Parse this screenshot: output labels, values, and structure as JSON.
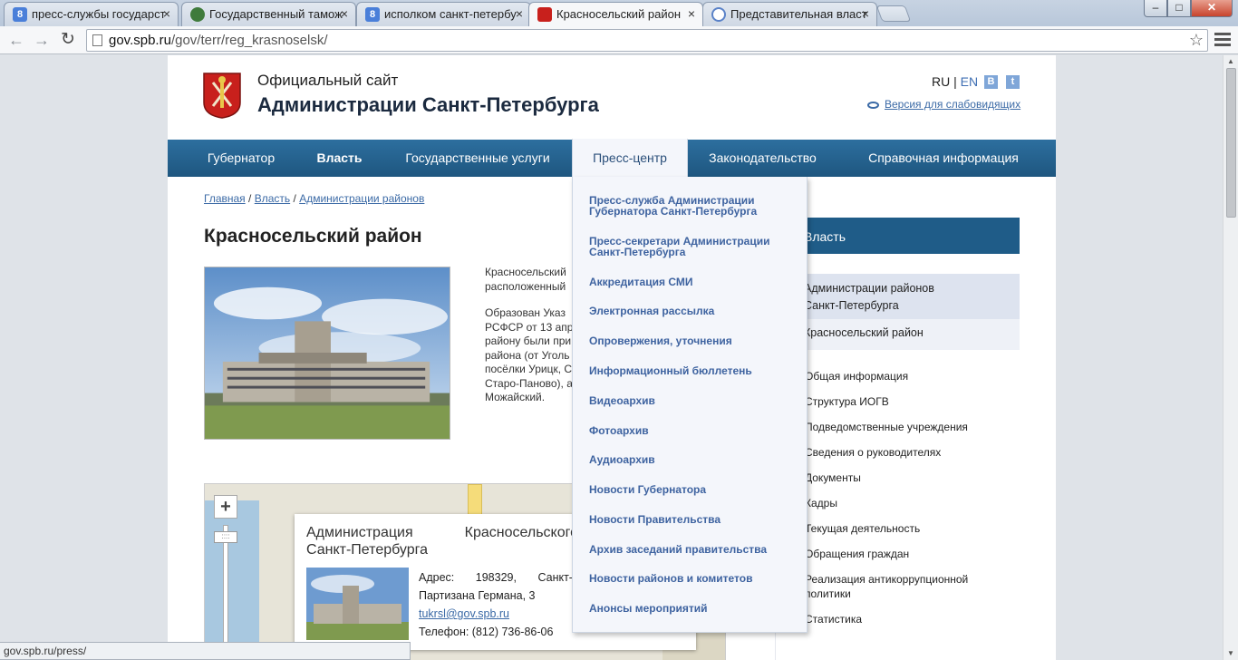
{
  "browser": {
    "tabs": [
      {
        "label": "пресс-службы государст",
        "icon": "google-icon"
      },
      {
        "label": "Государственный тамож",
        "icon": "customs-shield-icon"
      },
      {
        "label": "исполком санкт-петербу",
        "icon": "google-icon"
      },
      {
        "label": "Красносельский район",
        "icon": "spb-coat-of-arms-icon"
      },
      {
        "label": "Представительная власт",
        "icon": "globe-icon"
      }
    ],
    "address": {
      "domain": "gov.spb.ru",
      "path": "/gov/terr/reg_krasnoselsk/"
    },
    "status_url": "gov.spb.ru/press/",
    "close_glyph": "×"
  },
  "site": {
    "title_line1": "Официальный сайт",
    "title_line2": "Администрации Санкт-Петербурга",
    "lang_ru": "RU",
    "lang_sep": "|",
    "lang_en": "EN",
    "vk_label": "B",
    "twitter_label": "t",
    "low_vision": "Версия для слабовидящих",
    "colors": {
      "nav": "#1e567f",
      "link": "#3b6aa6",
      "sidebar_head": "#1f5c88",
      "dropdown_bg": "#f4f6fb"
    }
  },
  "nav": {
    "governor": "Губернатор",
    "power": "Власть",
    "services": "Государственные услуги",
    "press": "Пресс-центр",
    "law": "Законодательство",
    "info": "Справочная информация"
  },
  "breadcrumb": {
    "home": "Главная",
    "power": "Власть",
    "districts": "Администрации районов",
    "sep": "/"
  },
  "page": {
    "title": "Красносельский район",
    "intro_p1": [
      "Красносельский",
      "расположенный"
    ],
    "intro_p2": [
      "Образован Указ",
      "РСФСР от 13 апр",
      "району были при",
      "района (от Уголь",
      "посёлки Урицк, С",
      "Старо-Паново), а",
      "Можайский."
    ]
  },
  "map": {
    "zoom_in": "+",
    "knob": "::::",
    "card": {
      "title_w1": "Администрация",
      "title_w2": "Красносельского",
      "title_line2": "Санкт-Петербурга",
      "address_label": "Адрес:",
      "address_zip": "198329,",
      "address_city": "Санкт-",
      "address_street": "Партизана Германа, 3",
      "email": "tukrsl@gov.spb.ru",
      "phone": "Телефон: (812) 736-86-06"
    }
  },
  "sidebar": {
    "head": "Власть",
    "selected_l1": "Администрации районов",
    "selected_l2": "Санкт-Петербурга",
    "current": "Красносельский район",
    "items": [
      "Общая информация",
      "Структура ИОГВ",
      "Подведомственные учреждения",
      "Сведения о руководителях",
      "Документы",
      "Кадры",
      "Текущая деятельность",
      "Обращения граждан",
      "Реализация антикоррупционной",
      "политики",
      "Статистика"
    ]
  },
  "press_menu": [
    "Пресс-служба Администрации Губернатора Санкт-Петербурга",
    "Пресс-секретари Администрации Санкт-Петербурга",
    "Аккредитация СМИ",
    "Электронная рассылка",
    "Опровержения, уточнения",
    "Информационный бюллетень",
    "Видеоархив",
    "Фотоархив",
    "Аудиоархив",
    "Новости Губернатора",
    "Новости Правительства",
    "Архив заседаний правительства",
    "Новости районов и комитетов",
    "Анонсы мероприятий"
  ]
}
